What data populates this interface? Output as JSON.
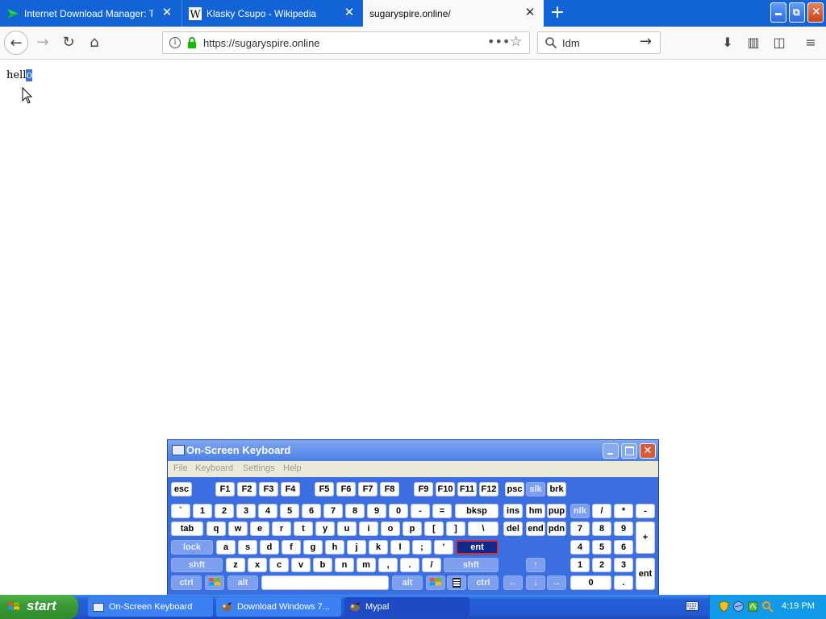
{
  "browser": {
    "tabs": [
      {
        "title": "Internet Download Manager: The",
        "icon": "idm-icon"
      },
      {
        "title": "Klasky Csupo - Wikipedia",
        "icon": "wikipedia-icon"
      },
      {
        "title": "sugaryspire.online/",
        "icon": ""
      }
    ],
    "address": "https://sugaryspire.online",
    "search_value": "Idm",
    "nav": {
      "back": "←",
      "forward": "→",
      "reload": "↻",
      "home": "⌂",
      "more": "•••",
      "star": "☆",
      "go": "→"
    },
    "toolbar": {
      "download": "⬇",
      "library": "▥",
      "sidebar": "◫",
      "menu": "≡"
    }
  },
  "page": {
    "text_plain": "hell",
    "text_selected": "o"
  },
  "osk": {
    "title": "On-Screen Keyboard",
    "menu": [
      "File",
      "Keyboard",
      "Settings",
      "Help"
    ],
    "keys": {
      "esc": "esc",
      "f1": "F1",
      "f2": "F2",
      "f3": "F3",
      "f4": "F4",
      "f5": "F5",
      "f6": "F6",
      "f7": "F7",
      "f8": "F8",
      "f9": "F9",
      "f10": "F10",
      "f11": "F11",
      "f12": "F12",
      "psc": "psc",
      "slk": "slk",
      "brk": "brk",
      "grave": "`",
      "d1": "1",
      "d2": "2",
      "d3": "3",
      "d4": "4",
      "d5": "5",
      "d6": "6",
      "d7": "7",
      "d8": "8",
      "d9": "9",
      "d0": "0",
      "minus": "-",
      "equals": "=",
      "bksp": "bksp",
      "ins": "ins",
      "hm": "hm",
      "pup": "pup",
      "nlk": "nlk",
      "np_div": "/",
      "np_mul": "*",
      "np_sub": "-",
      "tab": "tab",
      "q": "q",
      "w": "w",
      "e": "e",
      "r": "r",
      "t": "t",
      "y": "y",
      "u": "u",
      "i": "i",
      "o": "o",
      "p": "p",
      "lbr": "[",
      "rbr": "]",
      "bslash": "\\",
      "del": "del",
      "end": "end",
      "pdn": "pdn",
      "np7": "7",
      "np8": "8",
      "np9": "9",
      "np_add": "+",
      "lock": "lock",
      "a": "a",
      "s": "s",
      "d": "d",
      "f": "f",
      "g": "g",
      "h": "h",
      "j": "j",
      "k": "k",
      "l": "l",
      "semi": ";",
      "quote": "'",
      "ent": "ent",
      "np4": "4",
      "np5": "5",
      "np6": "6",
      "lshft": "shft",
      "z": "z",
      "x": "x",
      "c": "c",
      "v": "v",
      "b": "b",
      "n": "n",
      "m": "m",
      "comma": ",",
      "period": ".",
      "slash": "/",
      "rshft": "shft",
      "up": "↑",
      "np1": "1",
      "np2": "2",
      "np3": "3",
      "np_ent": "ent",
      "lctrl": "ctrl",
      "lalt": "alt",
      "ralt": "alt",
      "rctrl": "ctrl",
      "left": "←",
      "down": "↓",
      "right": "→",
      "np0": "0",
      "np_dot": "."
    }
  },
  "taskbar": {
    "start_label": "start",
    "items": [
      {
        "label": "On-Screen Keyboard",
        "icon": "keyboard-icon"
      },
      {
        "label": "Download Windows 7...",
        "icon": "mypal-icon"
      },
      {
        "label": "Mypal",
        "icon": "mypal-icon"
      }
    ],
    "clock": "4:19 PM"
  },
  "colors": {
    "tab_strip": "#1163d6",
    "osk_body": "#3b6ee0",
    "selection": "#3874d8",
    "taskbar": "#2459d3",
    "start": "#3b9a36",
    "tray": "#109ae8"
  }
}
